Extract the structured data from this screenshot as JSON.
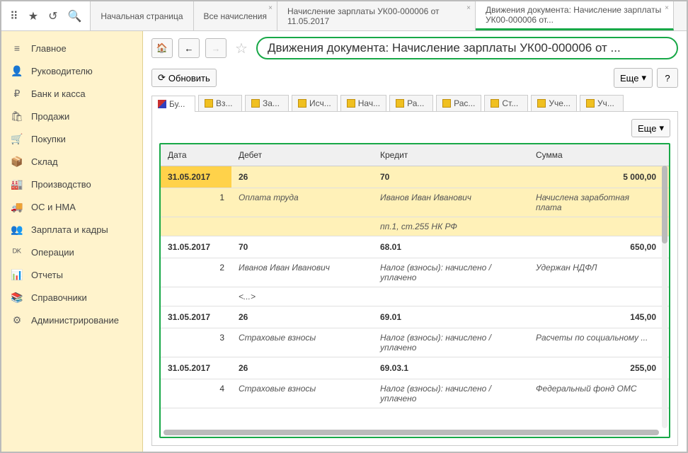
{
  "top_tabs": [
    {
      "label": "Начальная страница",
      "close": false
    },
    {
      "label": "Все начисления",
      "close": true
    },
    {
      "label": "Начисление зарплаты УК00-000006 от 11.05.2017",
      "close": true
    },
    {
      "label": "Движения документа: Начисление зарплаты УК00-000006 от...",
      "close": true,
      "active": true
    }
  ],
  "sidebar": [
    {
      "icon": "≡",
      "label": "Главное"
    },
    {
      "icon": "👤",
      "label": "Руководителю"
    },
    {
      "icon": "₽",
      "label": "Банк и касса"
    },
    {
      "icon": "🛍",
      "label": "Продажи"
    },
    {
      "icon": "🛒",
      "label": "Покупки"
    },
    {
      "icon": "📦",
      "label": "Склад"
    },
    {
      "icon": "🏭",
      "label": "Производство"
    },
    {
      "icon": "🚚",
      "label": "ОС и НМА"
    },
    {
      "icon": "👥",
      "label": "Зарплата и кадры"
    },
    {
      "icon": "ᴰᴷ",
      "label": "Операции"
    },
    {
      "icon": "📊",
      "label": "Отчеты"
    },
    {
      "icon": "📚",
      "label": "Справочники"
    },
    {
      "icon": "⚙",
      "label": "Администрирование"
    }
  ],
  "page_title": "Движения документа: Начисление зарплаты УК00-000006 от ...",
  "refresh_label": "Обновить",
  "more_label": "Еще",
  "help_label": "?",
  "doc_tabs": [
    "Бу...",
    "Вз...",
    "За...",
    "Исч...",
    "Нач...",
    "Ра...",
    "Рас...",
    "Ст...",
    "Уче...",
    "Уч..."
  ],
  "columns": {
    "date": "Дата",
    "debit": "Дебет",
    "credit": "Кредит",
    "sum": "Сумма"
  },
  "rows": [
    {
      "hl": true,
      "main": {
        "date": "31.05.2017",
        "debit": "26",
        "credit": "70",
        "sum": "5 000,00"
      },
      "subs": [
        {
          "n": "1",
          "debit": "Оплата труда",
          "credit": "Иванов Иван Иванович",
          "sum": "Начислена заработная плата"
        },
        {
          "n": "",
          "debit": "",
          "credit": "пп.1, ст.255 НК РФ",
          "sum": ""
        }
      ]
    },
    {
      "main": {
        "date": "31.05.2017",
        "debit": "70",
        "credit": "68.01",
        "sum": "650,00"
      },
      "subs": [
        {
          "n": "2",
          "debit": "Иванов Иван Иванович",
          "credit": "Налог (взносы): начислено / уплачено",
          "sum": "Удержан НДФЛ"
        },
        {
          "n": "",
          "debit": "<...>",
          "credit": "",
          "sum": ""
        }
      ]
    },
    {
      "main": {
        "date": "31.05.2017",
        "debit": "26",
        "credit": "69.01",
        "sum": "145,00"
      },
      "subs": [
        {
          "n": "3",
          "debit": "Страховые взносы",
          "credit": "Налог (взносы): начислено / уплачено",
          "sum": "Расчеты по социальному ..."
        }
      ]
    },
    {
      "main": {
        "date": "31.05.2017",
        "debit": "26",
        "credit": "69.03.1",
        "sum": "255,00"
      },
      "subs": [
        {
          "n": "4",
          "debit": "Страховые взносы",
          "credit": "Налог (взносы): начислено / уплачено",
          "sum": "Федеральный фонд ОМС"
        }
      ]
    }
  ]
}
